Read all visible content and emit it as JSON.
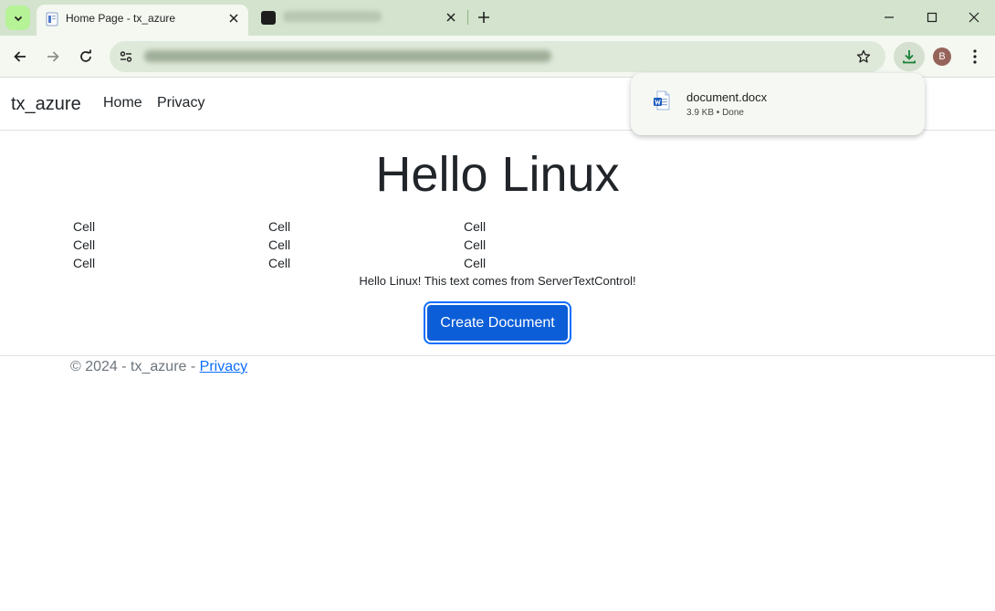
{
  "browser": {
    "active_tab_title": "Home Page - tx_azure",
    "avatar_letter": "B",
    "accent_color": "#b6f296"
  },
  "nav": {
    "brand": "tx_azure",
    "links": [
      "Home",
      "Privacy"
    ]
  },
  "main": {
    "heading": "Hello Linux",
    "table": [
      [
        "Cell",
        "Cell",
        "Cell"
      ],
      [
        "Cell",
        "Cell",
        "Cell"
      ],
      [
        "Cell",
        "Cell",
        "Cell"
      ]
    ],
    "server_text": "Hello Linux! This text comes from ServerTextControl!",
    "create_button": "Create Document",
    "button_color": "#0b5ed7"
  },
  "footer": {
    "text": "© 2024 - tx_azure - ",
    "link": "Privacy"
  },
  "download": {
    "file_name": "document.docx",
    "meta": "3.9 KB • Done"
  }
}
